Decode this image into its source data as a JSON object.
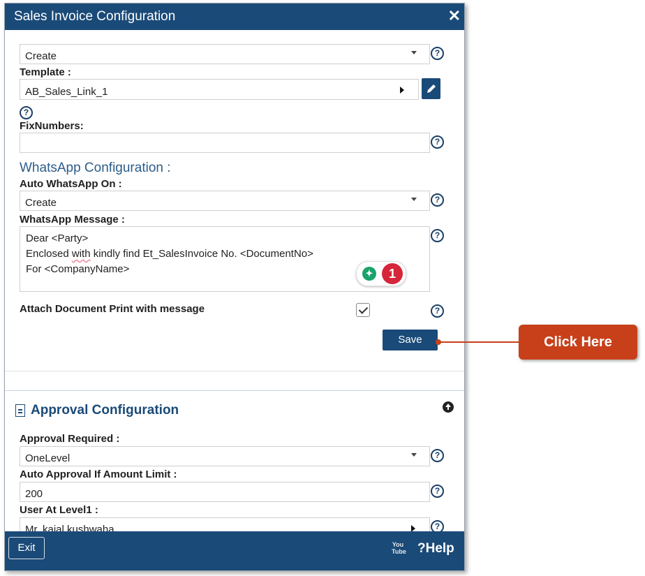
{
  "window": {
    "title": "Sales Invoice Configuration",
    "close_icon": "close-icon"
  },
  "sales": {
    "mode_value": "Create",
    "template_label": "Template :",
    "template_value": "AB_Sales_Link_1",
    "fixnumbers_label": "FixNumbers:",
    "fixnumbers_value": ""
  },
  "whatsapp": {
    "section_title": "WhatsApp Configuration :",
    "auto_on_label": "Auto WhatsApp On :",
    "auto_on_value": "Create",
    "message_label": "WhatsApp Message :",
    "message_line1": "Dear <Party>",
    "message_line2_before": "Enclosed ",
    "message_line2_spell": "with",
    "message_line2_after": " kindly find Et_SalesInvoice No. <DocumentNo>",
    "message_line3": "For <CompanyName>",
    "grammar_badge_count": "1",
    "attach_label": "Attach Document Print with message",
    "attach_checked": true
  },
  "buttons": {
    "save": "Save",
    "exit": "Exit",
    "help": "?Help"
  },
  "approval": {
    "section_title": "Approval Configuration",
    "required_label": "Approval Required :",
    "required_value": "OneLevel",
    "amount_label": "Auto Approval If Amount Limit :",
    "amount_value": "200",
    "user_label": "User At Level1 :",
    "user_value": "Mr. kajal kushwaha"
  },
  "callout": {
    "text": "Click Here"
  },
  "colors": {
    "header": "#1a4a78",
    "callout": "#c8401a",
    "section_title": "#2b5d8a"
  }
}
